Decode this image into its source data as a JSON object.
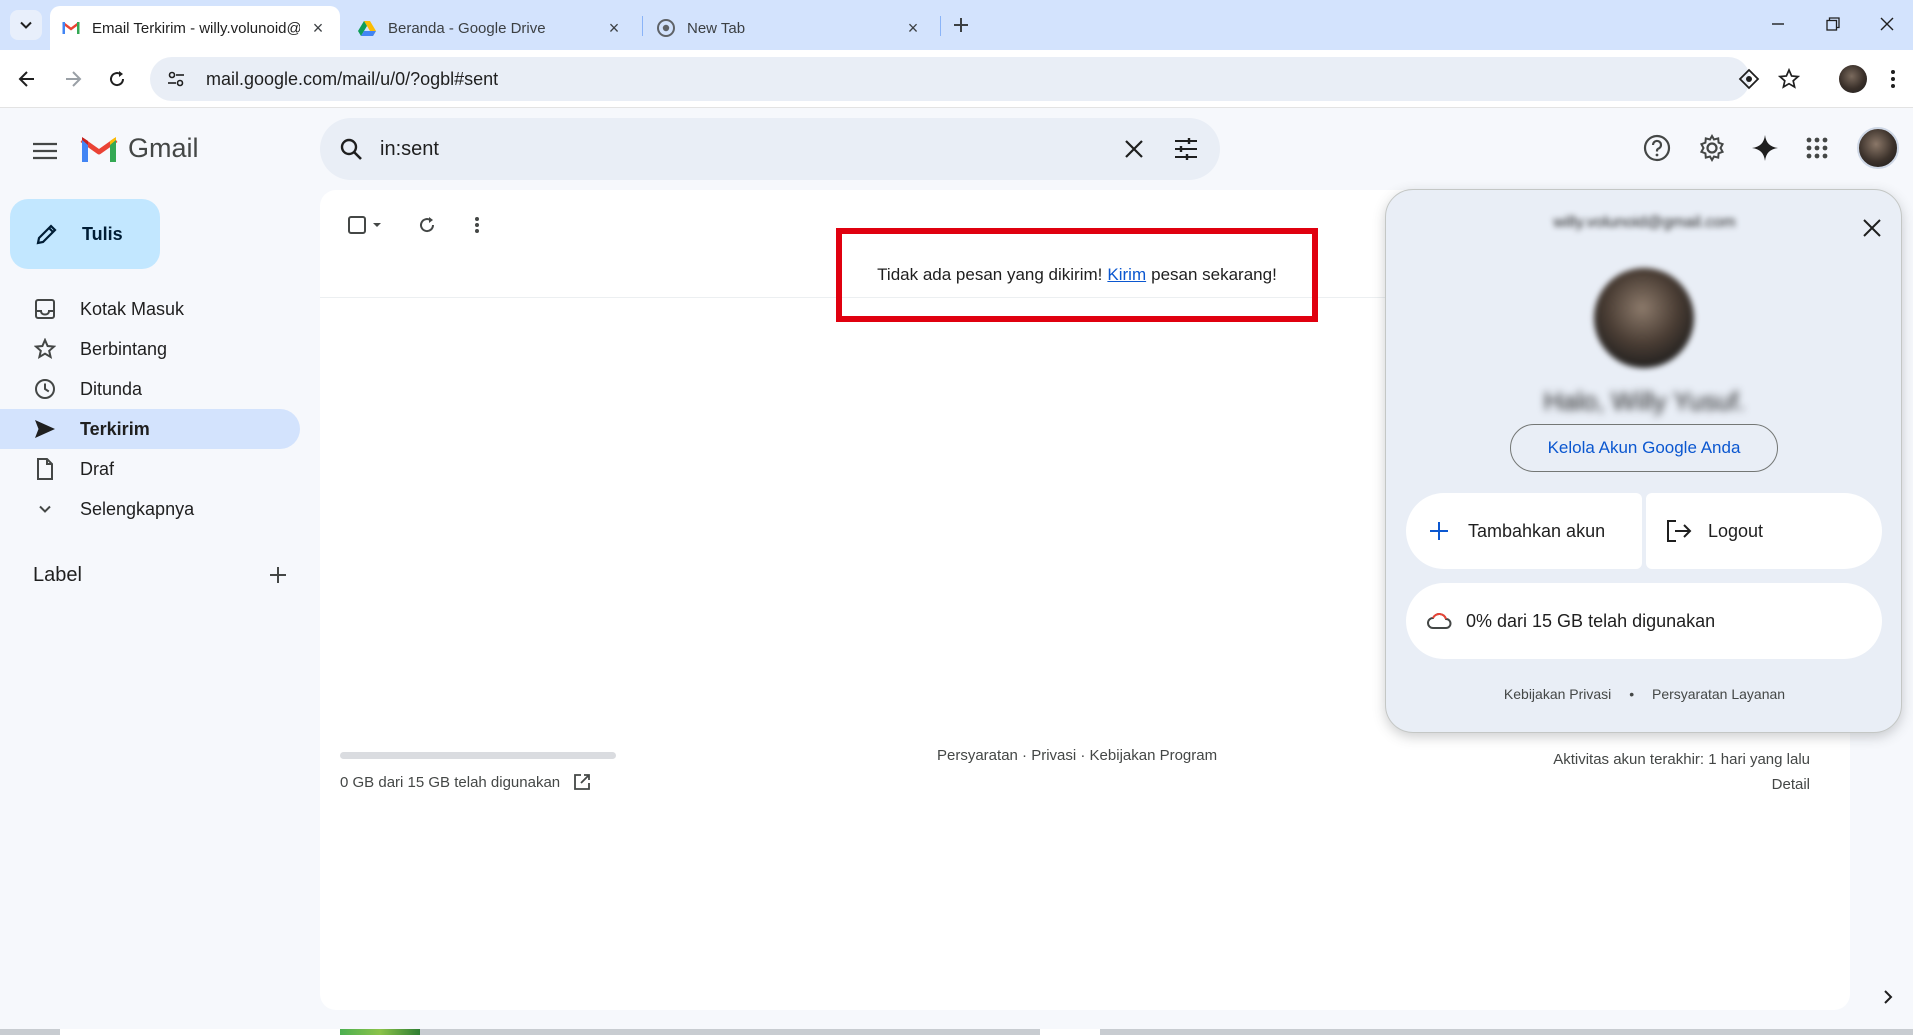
{
  "browser": {
    "tabs": [
      {
        "title": "Email Terkirim - willy.volunoid@",
        "active": true,
        "favicon": "gmail-icon"
      },
      {
        "title": "Beranda - Google Drive",
        "active": false,
        "favicon": "google-drive-icon"
      },
      {
        "title": "New Tab",
        "active": false,
        "favicon": "chrome-icon"
      }
    ],
    "url": "mail.google.com/mail/u/0/?ogbl#sent"
  },
  "gmail": {
    "app_name": "Gmail",
    "search_query": "in:sent",
    "compose_label": "Tulis",
    "nav": [
      {
        "label": "Kotak Masuk",
        "icon": "inbox-icon",
        "active": false
      },
      {
        "label": "Berbintang",
        "icon": "star-icon",
        "active": false
      },
      {
        "label": "Ditunda",
        "icon": "clock-icon",
        "active": false
      },
      {
        "label": "Terkirim",
        "icon": "send-icon",
        "active": true
      },
      {
        "label": "Draf",
        "icon": "draft-icon",
        "active": false
      },
      {
        "label": "Selengkapnya",
        "icon": "chevron-down-icon",
        "active": false
      }
    ],
    "label_heading": "Label"
  },
  "main": {
    "empty_before": "Tidak ada pesan yang dikirim!",
    "empty_link": "Kirim",
    "empty_after": "pesan sekarang!",
    "storage_text": "0 GB dari 15 GB telah digunakan",
    "storage_fraction": 0.0,
    "footer_links": "Persyaratan · Privasi · Kebijakan Program",
    "last_activity": "Aktivitas akun terakhir: 1 hari yang lalu",
    "details": "Detail"
  },
  "account": {
    "email": "willy.volunoid@gmail.com",
    "greeting": "Halo, Willy Yusuf.",
    "manage_label": "Kelola Akun Google Anda",
    "add_account": "Tambahkan akun",
    "logout": "Logout",
    "storage": "0% dari 15 GB telah digunakan",
    "privacy": "Kebijakan Privasi",
    "dot": "•",
    "terms": "Persyaratan Layanan"
  },
  "colors": {
    "accent": "#0b57d0",
    "compose_bg": "#c2e7ff",
    "active_nav_bg": "#d3e3fd",
    "highlight_box": "#e0000f"
  }
}
